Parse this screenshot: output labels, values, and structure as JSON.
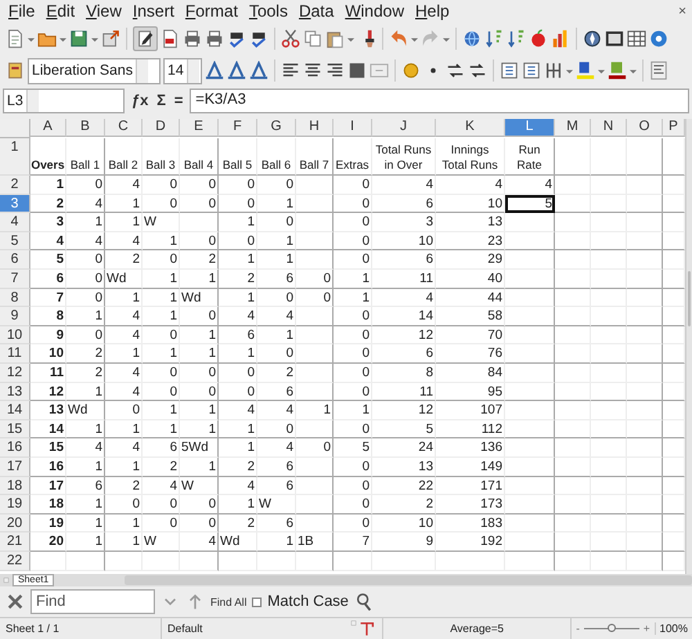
{
  "menu": [
    "File",
    "Edit",
    "View",
    "Insert",
    "Format",
    "Tools",
    "Data",
    "Window",
    "Help"
  ],
  "menu_close": "×",
  "formatting": {
    "font_name": "Liberation Sans",
    "font_size": "14"
  },
  "formula_bar": {
    "cell_reference": "L3",
    "function_symbol": "ƒx",
    "sum_symbol": "Σ",
    "equals_symbol": "=",
    "formula": "=K3/A3"
  },
  "columns": [
    {
      "label": "A",
      "selected": false
    },
    {
      "label": "B",
      "selected": false
    },
    {
      "label": "C",
      "selected": false
    },
    {
      "label": "D",
      "selected": false
    },
    {
      "label": "E",
      "selected": false
    },
    {
      "label": "F",
      "selected": false
    },
    {
      "label": "G",
      "selected": false
    },
    {
      "label": "H",
      "selected": false
    },
    {
      "label": "I",
      "selected": false
    },
    {
      "label": "J",
      "selected": false
    },
    {
      "label": "K",
      "selected": false
    },
    {
      "label": "L",
      "selected": true
    },
    {
      "label": "M",
      "selected": false
    },
    {
      "label": "N",
      "selected": false
    },
    {
      "label": "O",
      "selected": false
    },
    {
      "label": "P",
      "selected": false
    }
  ],
  "header_row": {
    "number": "1",
    "selected": false,
    "cells": [
      "Overs",
      "Ball 1",
      "Ball 2",
      "Ball 3",
      "Ball 4",
      "Ball 5",
      "Ball 6",
      "Ball 7",
      "Extras",
      "Total Runs\nin Over",
      "Innings\nTotal Runs",
      "Run Rate"
    ]
  },
  "rows": [
    {
      "number": "2",
      "selected": false,
      "cells": [
        "1",
        "0",
        "4",
        "0",
        "0",
        "0",
        "0",
        "",
        "0",
        "4",
        "4",
        "4"
      ]
    },
    {
      "number": "3",
      "selected": true,
      "cells": [
        "2",
        "4",
        "1",
        "0",
        "0",
        "0",
        "1",
        "",
        "0",
        "6",
        "10",
        "5"
      ]
    },
    {
      "number": "4",
      "selected": false,
      "cells": [
        "3",
        "1",
        "1",
        {
          "text": "W"
        },
        "",
        "1",
        "0",
        "",
        "0",
        "3",
        "13",
        ""
      ]
    },
    {
      "number": "5",
      "selected": false,
      "cells": [
        "4",
        "4",
        "4",
        "1",
        "0",
        "0",
        "1",
        "",
        "0",
        "10",
        "23",
        ""
      ]
    },
    {
      "number": "6",
      "selected": false,
      "cells": [
        "5",
        "0",
        "2",
        "0",
        "2",
        "1",
        "1",
        "",
        "0",
        "6",
        "29",
        ""
      ]
    },
    {
      "number": "7",
      "selected": false,
      "cells": [
        "6",
        "0",
        {
          "text": "Wd"
        },
        "1",
        "1",
        "2",
        "6",
        "0",
        "1",
        "11",
        "40",
        ""
      ]
    },
    {
      "number": "8",
      "selected": false,
      "cells": [
        "7",
        "0",
        "1",
        "1",
        {
          "text": "Wd"
        },
        "1",
        "0",
        "0",
        "1",
        "4",
        "44",
        ""
      ]
    },
    {
      "number": "9",
      "selected": false,
      "cells": [
        "8",
        "1",
        "4",
        "1",
        "0",
        "4",
        "4",
        "",
        "0",
        "14",
        "58",
        ""
      ]
    },
    {
      "number": "10",
      "selected": false,
      "cells": [
        "9",
        "0",
        "4",
        "0",
        "1",
        "6",
        "1",
        "",
        "0",
        "12",
        "70",
        ""
      ]
    },
    {
      "number": "11",
      "selected": false,
      "cells": [
        "10",
        "2",
        "1",
        "1",
        "1",
        "1",
        "0",
        "",
        "0",
        "6",
        "76",
        ""
      ]
    },
    {
      "number": "12",
      "selected": false,
      "cells": [
        "11",
        "2",
        "4",
        "0",
        "0",
        "0",
        "2",
        "",
        "0",
        "8",
        "84",
        ""
      ]
    },
    {
      "number": "13",
      "selected": false,
      "cells": [
        "12",
        "1",
        "4",
        "0",
        "0",
        "0",
        "6",
        "",
        "0",
        "11",
        "95",
        ""
      ]
    },
    {
      "number": "14",
      "selected": false,
      "cells": [
        "13",
        {
          "text": "Wd"
        },
        "0",
        "1",
        "1",
        "4",
        "4",
        "1",
        "1",
        "12",
        "107",
        ""
      ]
    },
    {
      "number": "15",
      "selected": false,
      "cells": [
        "14",
        "1",
        "1",
        "1",
        "1",
        "1",
        "0",
        "",
        "0",
        "5",
        "112",
        ""
      ]
    },
    {
      "number": "16",
      "selected": false,
      "cells": [
        "15",
        "4",
        "4",
        "6",
        {
          "text": "5Wd"
        },
        "1",
        "4",
        "0",
        "5",
        "24",
        "136",
        ""
      ]
    },
    {
      "number": "17",
      "selected": false,
      "cells": [
        "16",
        "1",
        "1",
        "2",
        "1",
        "2",
        "6",
        "",
        "0",
        "13",
        "149",
        ""
      ]
    },
    {
      "number": "18",
      "selected": false,
      "cells": [
        "17",
        "6",
        "2",
        "4",
        {
          "text": "W"
        },
        "4",
        "6",
        "",
        "0",
        "22",
        "171",
        ""
      ]
    },
    {
      "number": "19",
      "selected": false,
      "cells": [
        "18",
        "1",
        "0",
        "0",
        "0",
        "1",
        {
          "text": "W"
        },
        "",
        "0",
        "2",
        "173",
        ""
      ]
    },
    {
      "number": "20",
      "selected": false,
      "cells": [
        "19",
        "1",
        "1",
        "0",
        "0",
        "2",
        "6",
        "",
        "0",
        "10",
        "183",
        ""
      ]
    },
    {
      "number": "21",
      "selected": false,
      "cells": [
        "20",
        "1",
        "1",
        {
          "text": "W"
        },
        "4",
        {
          "text": "Wd"
        },
        "1",
        {
          "text": "1B"
        },
        "7",
        "9",
        "192",
        ""
      ]
    },
    {
      "number": "22",
      "selected": false,
      "cells": []
    }
  ],
  "sheet_tab": "Sheet1",
  "find_bar": {
    "placeholder": "Find",
    "find_all": "Find All",
    "match_case": {
      "label": "Match Case",
      "checked": false
    }
  },
  "status_bar": {
    "sheet": "Sheet 1 / 1",
    "page_style": "Default",
    "summary": "Average=5",
    "zoom_out": "-",
    "zoom_in": "+",
    "zoom": {
      "level": 0.5,
      "reading": "100%"
    }
  }
}
